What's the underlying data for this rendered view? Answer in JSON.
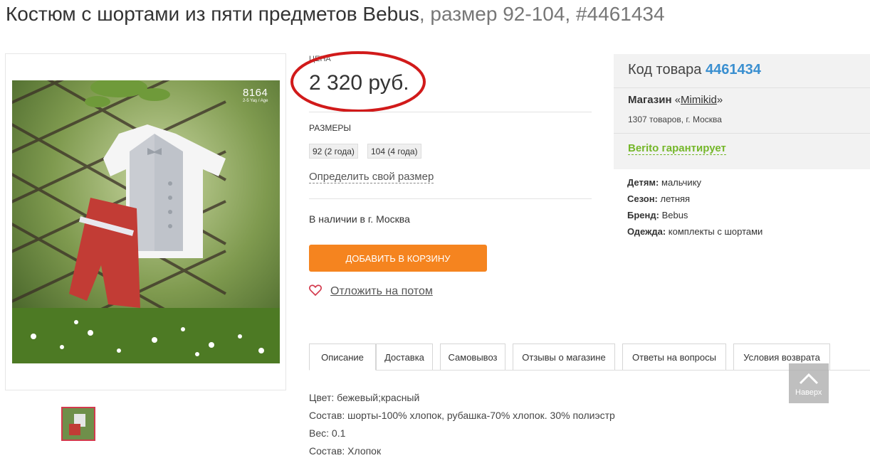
{
  "product": {
    "title_main": "Костюм с шортами из пяти предметов Bebus",
    "title_sub": ", размер 92-104, #4461434",
    "price_label": "цена",
    "price": "2 320 руб.",
    "image_overlay_code": "8164",
    "image_overlay_age": "2-5 Yaş / Age",
    "sizes_label": "размеры",
    "sizes": [
      "92 (2 года)",
      "104 (4 года)"
    ],
    "size_link": "Определить свой размер",
    "stock": "В наличии в г. Москва",
    "add_to_cart": "Добавить в корзину",
    "save_later": "Отложить на потом"
  },
  "info": {
    "code_label": "Код товара",
    "code": "4461434",
    "shop_label": "Магазин",
    "shop_open": " «",
    "shop_name": "Mimikid",
    "shop_close": "»",
    "shop_meta": "1307 товаров, г. Москва",
    "guarantee": "Berito гарантирует",
    "props": [
      {
        "key": "Детям:",
        "value": " мальчику"
      },
      {
        "key": "Сезон:",
        "value": " летняя"
      },
      {
        "key": "Бренд:",
        "value": " Bebus"
      },
      {
        "key": "Одежда:",
        "value": " комплекты с шортами"
      }
    ]
  },
  "tabs": [
    "Описание",
    "Доставка",
    "Самовывоз",
    "Отзывы о магазине",
    "Ответы на вопросы",
    "Условия возврата"
  ],
  "description": [
    "Цвет: бежевый;красный",
    "Состав: шорты-100% хлопок, рубашка-70% хлопок. 30% полиэстр",
    "Вес: 0.1",
    "Состав: Хлопок"
  ],
  "scroll_up": "Наверх",
  "colors": {
    "accent_orange": "#f5841f",
    "link_blue": "#3a8fd0",
    "guarantee_green": "#75b72a",
    "annotation_red": "#d11a1a"
  }
}
